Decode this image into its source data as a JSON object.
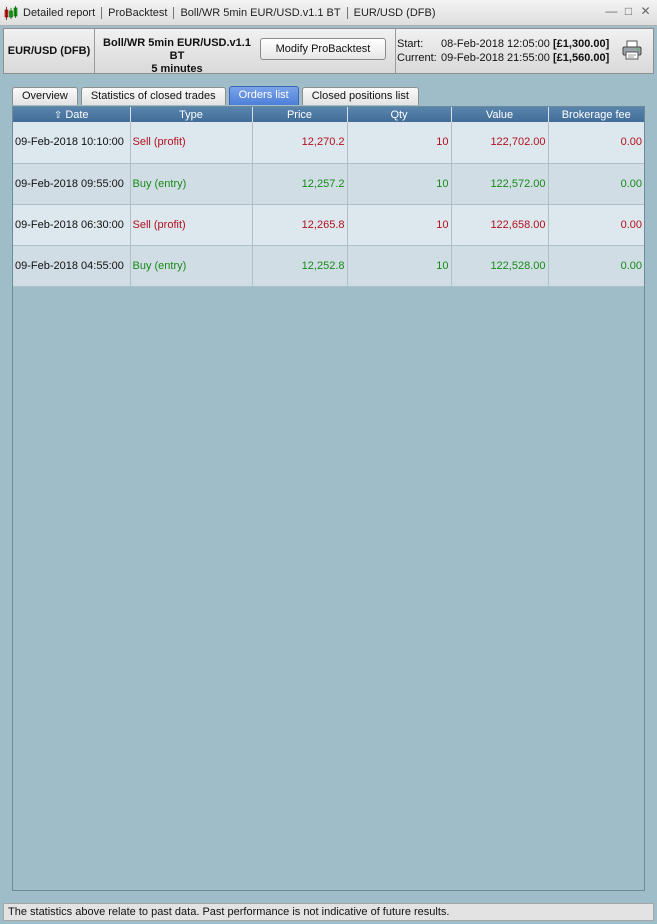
{
  "titlebar": {
    "crumbs": [
      "Detailed report",
      "ProBacktest",
      "Boll/WR 5min EUR/USD.v1.1 BT",
      "EUR/USD (DFB)"
    ],
    "minimize": "—",
    "maximize": "□",
    "close": "✕"
  },
  "header": {
    "ticker": "EUR/USD (DFB)",
    "strategy_name": "Boll/WR 5min EUR/USD.v1.1 BT",
    "timeframe": "5 minutes",
    "modify_label": "Modify ProBacktest",
    "start_label": "Start:",
    "start_date": "08-Feb-2018 12:05:00",
    "start_amount": "[£1,300.00]",
    "current_label": "Current:",
    "current_date": "09-Feb-2018 21:55:00",
    "current_amount": "[£1,560.00]"
  },
  "tabs": [
    {
      "label": "Overview",
      "active": false
    },
    {
      "label": "Statistics of closed trades",
      "active": false
    },
    {
      "label": "Orders list",
      "active": true
    },
    {
      "label": "Closed positions list",
      "active": false
    }
  ],
  "table": {
    "columns": [
      "Date",
      "Type",
      "Price",
      "Qty",
      "Value",
      "Brokerage fee"
    ],
    "sort_arrow": "⇧",
    "rows": [
      {
        "date": "09-Feb-2018 10:10:00",
        "type": "Sell (profit)",
        "price": "12,270.2",
        "qty": "10",
        "value": "122,702.00",
        "fee": "0.00",
        "color": "#b4101e"
      },
      {
        "date": "09-Feb-2018 09:55:00",
        "type": "Buy (entry)",
        "price": "12,257.2",
        "qty": "10",
        "value": "122,572.00",
        "fee": "0.00",
        "color": "#168a16"
      },
      {
        "date": "09-Feb-2018 06:30:00",
        "type": "Sell (profit)",
        "price": "12,265.8",
        "qty": "10",
        "value": "122,658.00",
        "fee": "0.00",
        "color": "#b4101e"
      },
      {
        "date": "09-Feb-2018 04:55:00",
        "type": "Buy (entry)",
        "price": "12,252.8",
        "qty": "10",
        "value": "122,528.00",
        "fee": "0.00",
        "color": "#168a16"
      }
    ]
  },
  "footer": {
    "disclaimer": "The statistics above relate to past data. Past performance is not indicative of future results."
  },
  "colors": {
    "sell": "#b4101e",
    "buy": "#168a16",
    "header_blue": "#4d79a3",
    "active_tab": "#5b8ae0",
    "background": "#9fbcc9"
  }
}
